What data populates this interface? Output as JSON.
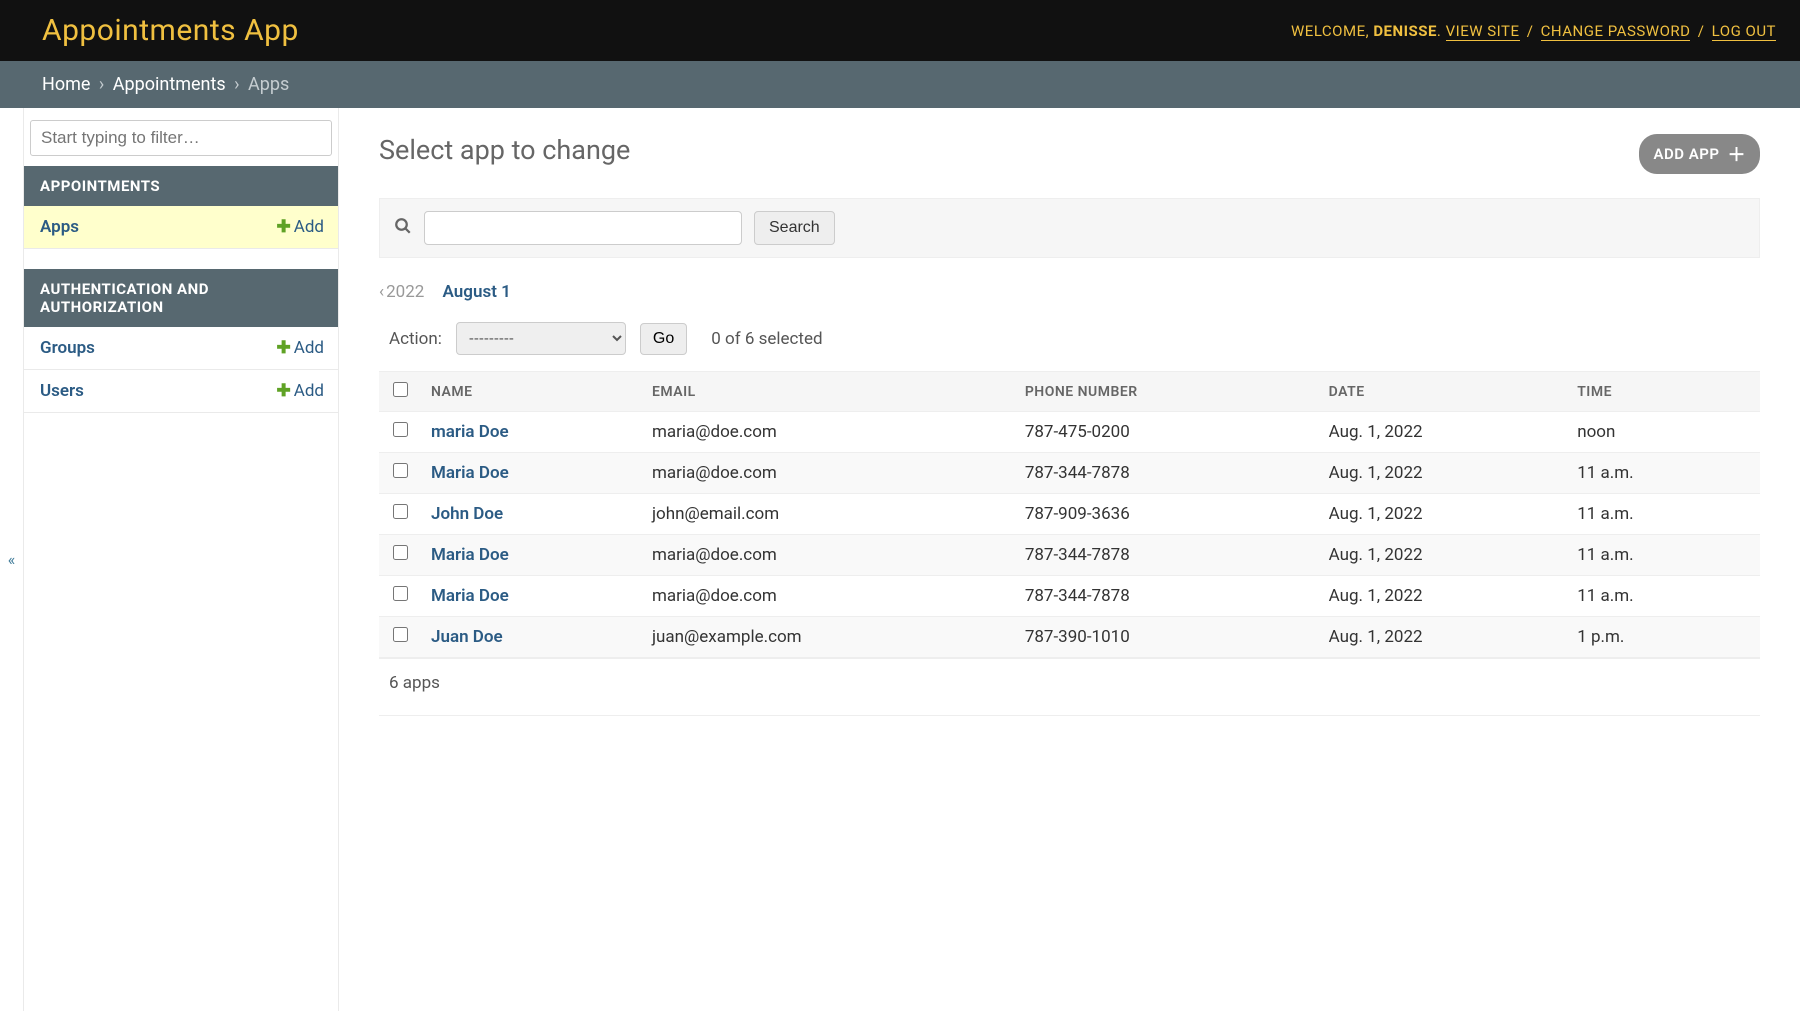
{
  "header": {
    "site_name": "Appointments App",
    "welcome": "WELCOME,",
    "username": "DENISSE",
    "view_site": "VIEW SITE",
    "change_password": "CHANGE PASSWORD",
    "log_out": "LOG OUT"
  },
  "breadcrumbs": {
    "home": "Home",
    "app": "Appointments",
    "current": "Apps"
  },
  "sidebar": {
    "filter_placeholder": "Start typing to filter…",
    "sections": [
      {
        "caption": "APPOINTMENTS",
        "models": [
          {
            "name": "Apps",
            "add": "Add",
            "current": true
          }
        ]
      },
      {
        "caption": "AUTHENTICATION AND AUTHORIZATION",
        "models": [
          {
            "name": "Groups",
            "add": "Add",
            "current": false
          },
          {
            "name": "Users",
            "add": "Add",
            "current": false
          }
        ]
      }
    ]
  },
  "content": {
    "title": "Select app to change",
    "add_button": "ADD APP",
    "search_button": "Search",
    "date_hierarchy": {
      "back": "2022",
      "current": "August 1"
    },
    "actions": {
      "label": "Action:",
      "selected_option": "---------",
      "go": "Go",
      "counter": "0 of 6 selected"
    },
    "columns": {
      "name": "NAME",
      "email": "EMAIL",
      "phone": "PHONE NUMBER",
      "date": "DATE",
      "time": "TIME"
    },
    "rows": [
      {
        "name": "maria Doe",
        "email": "maria@doe.com",
        "phone": "787-475-0200",
        "date": "Aug. 1, 2022",
        "time": "noon"
      },
      {
        "name": "Maria Doe",
        "email": "maria@doe.com",
        "phone": "787-344-7878",
        "date": "Aug. 1, 2022",
        "time": "11 a.m."
      },
      {
        "name": "John Doe",
        "email": "john@email.com",
        "phone": "787-909-3636",
        "date": "Aug. 1, 2022",
        "time": "11 a.m."
      },
      {
        "name": "Maria Doe",
        "email": "maria@doe.com",
        "phone": "787-344-7878",
        "date": "Aug. 1, 2022",
        "time": "11 a.m."
      },
      {
        "name": "Maria Doe",
        "email": "maria@doe.com",
        "phone": "787-344-7878",
        "date": "Aug. 1, 2022",
        "time": "11 a.m."
      },
      {
        "name": "Juan Doe",
        "email": "juan@example.com",
        "phone": "787-390-1010",
        "date": "Aug. 1, 2022",
        "time": "1 p.m."
      }
    ],
    "paginator": "6 apps"
  },
  "nav_toggle": "«"
}
